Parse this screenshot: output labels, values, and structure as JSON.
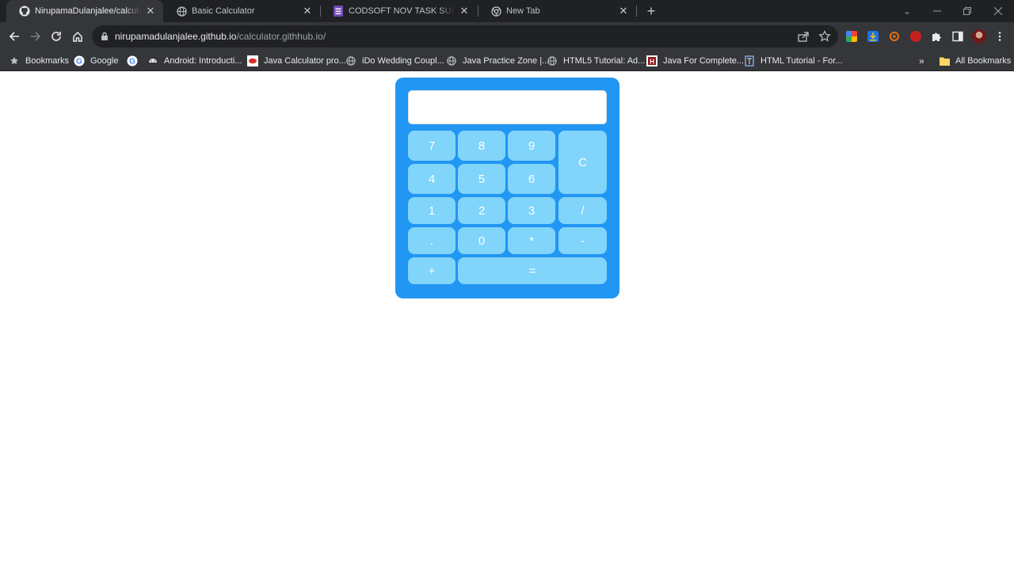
{
  "browser": {
    "tabs": [
      {
        "title": "NirupamaDulanjalee/calculator.",
        "icon": "github-icon"
      },
      {
        "title": "Basic Calculator",
        "icon": "globe-icon"
      },
      {
        "title": "CODSOFT NOV TASK SUBMISSI",
        "icon": "forms-icon"
      },
      {
        "title": "New Tab",
        "icon": "chrome-icon"
      }
    ],
    "url_host": "nirupamadulanjalee.github.io",
    "url_path": "/calculator.githhub.io/",
    "bookmarks_label": "Bookmarks",
    "bookmarks": [
      {
        "label": "Google",
        "icon": "google-icon"
      },
      {
        "label": "",
        "icon": "google-icon"
      },
      {
        "label": "Android: Introducti...",
        "icon": "android-icon"
      },
      {
        "label": "Java Calculator pro...",
        "icon": "red-site-icon"
      },
      {
        "label": "iDo Wedding Coupl...",
        "icon": "globe-icon"
      },
      {
        "label": "Java Practice Zone |...",
        "icon": "globe-icon"
      },
      {
        "label": "HTML5 Tutorial: Ad...",
        "icon": "globe-icon"
      },
      {
        "label": "Java For Complete...",
        "icon": "hl-icon"
      },
      {
        "label": "HTML Tutorial - For...",
        "icon": "doc-icon"
      }
    ],
    "overflow_label": "»",
    "all_bookmarks_label": "All Bookmarks"
  },
  "calculator": {
    "display_value": "",
    "keys": {
      "k7": "7",
      "k8": "8",
      "k9": "9",
      "clear": "C",
      "k4": "4",
      "k5": "5",
      "k6": "6",
      "k1": "1",
      "k2": "2",
      "k3": "3",
      "divide": "/",
      "dot": ".",
      "k0": "0",
      "multiply": "*",
      "subtract": "-",
      "add": "+",
      "equals": "="
    }
  }
}
